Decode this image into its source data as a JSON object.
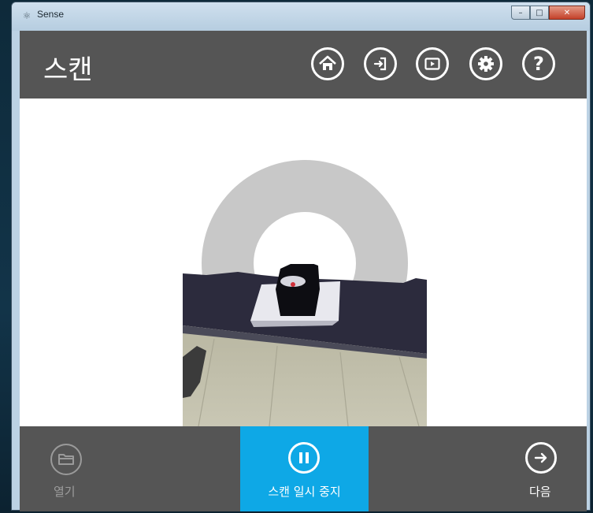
{
  "window": {
    "title": "Sense",
    "app_icon": "sense-icon"
  },
  "window_controls": {
    "minimize": "–",
    "maximize": "□",
    "close": "✕"
  },
  "header": {
    "title": "스캔",
    "buttons": [
      {
        "name": "home-icon"
      },
      {
        "name": "login-icon"
      },
      {
        "name": "play-icon"
      },
      {
        "name": "gear-icon"
      },
      {
        "name": "help-icon",
        "glyph": "?"
      }
    ]
  },
  "footer": {
    "open_label": "열기",
    "pause_label": "스캔 일시 중지",
    "next_label": "다음"
  },
  "colors": {
    "header_bg": "#555555",
    "accent": "#0ea8e6",
    "ring": "#c8c8c8",
    "disabled_text": "#9c9c9c"
  }
}
